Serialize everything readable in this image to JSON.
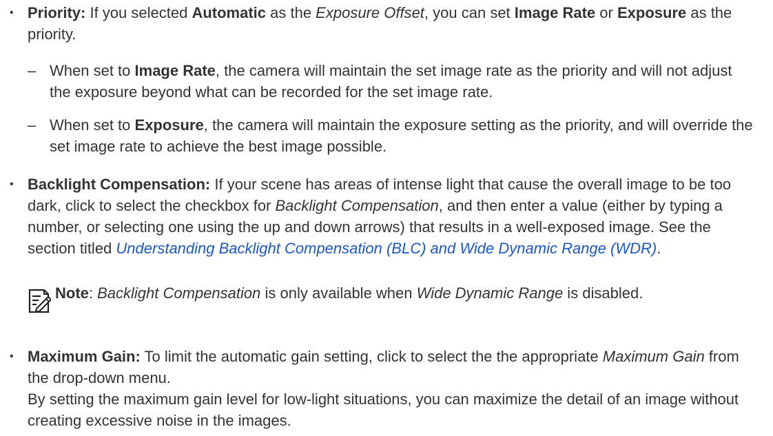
{
  "bullet_symbol": "•",
  "dash_symbol": "–",
  "priority": {
    "term": "Priority:",
    "t1": " If you selected ",
    "b1": "Automatic",
    "t2": " as the ",
    "i1": "Exposure Offset",
    "t3": ", you can set ",
    "b2": "Image Rate",
    "t4": " or ",
    "b3": "Exposure",
    "t5": " as the priority.",
    "sub1": {
      "t1": "When set to ",
      "b1": "Image Rate",
      "t2": ", the camera will maintain the set image rate as the priority and will not adjust the exposure beyond what can be recorded for the set image rate."
    },
    "sub2": {
      "t1": "When set to ",
      "b1": "Exposure",
      "t2": ", the camera will maintain the exposure setting as the priority, and will override the set image rate to achieve the best image possible."
    }
  },
  "backlight": {
    "term": "Backlight Compensation:",
    "t1": " If your scene has areas of intense light that cause the overall image to be too dark, click to select the checkbox for ",
    "i1": "Backlight Compensation",
    "t2": ", and then enter a value (either by typing a number, or selecting one using the up and down arrows) that results in a well-exposed image. See the section titled ",
    "link": "Understanding Backlight Compensation (BLC) and Wide Dynamic Range (WDR)",
    "t3": "."
  },
  "note": {
    "icon": "note-pencil-icon",
    "label": "Note",
    "t1": ": ",
    "i1": "Backlight Compensation",
    "t2": " is only available when ",
    "i2": "Wide Dynamic Range",
    "t3": " is disabled."
  },
  "gain": {
    "term": "Maximum Gain:",
    "t1": " To limit the automatic gain setting, click to select the the appropriate ",
    "i1": "Maximum Gain",
    "t2": " from the drop-down menu.",
    "p2": "By setting the maximum gain level for low-light situations, you can maximize the detail of an image without creating excessive noise in the images."
  }
}
